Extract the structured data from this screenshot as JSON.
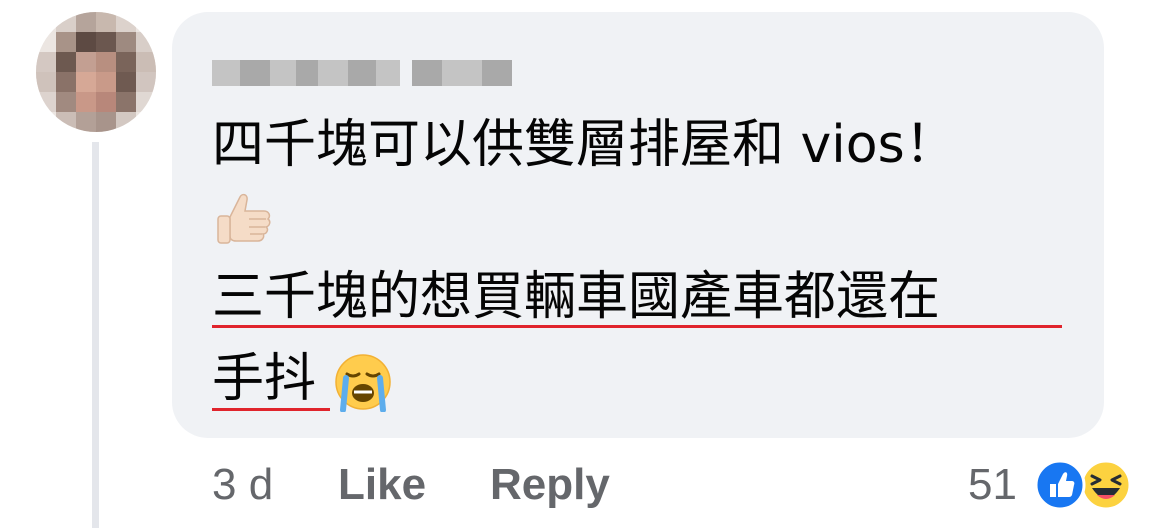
{
  "comment": {
    "author_name": "",
    "lines": [
      "四千塊可以供雙層排屋和 vios！",
      "三千塊的想買輛車國產車都還在",
      "手抖"
    ],
    "emojis": [
      "thumbs-up-light-skin",
      "loudly-crying-face"
    ],
    "underline_color": "#e0242c"
  },
  "footer": {
    "time": "3 d",
    "like_label": "Like",
    "reply_label": "Reply",
    "reaction_count": "51",
    "reactions": [
      "like-icon",
      "haha-icon"
    ]
  },
  "colors": {
    "bubble": "#f0f2f5",
    "meta_text": "#65676b",
    "like_blue": "#1877f2"
  }
}
